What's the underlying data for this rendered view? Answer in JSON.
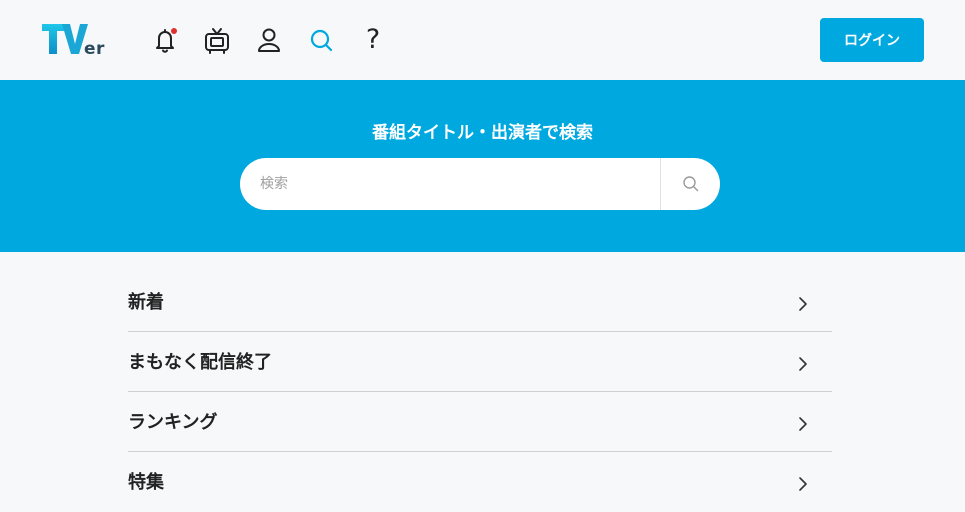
{
  "header": {
    "logo_text": "TVer",
    "icons": [
      {
        "name": "notification-bell-icon",
        "has_badge": true,
        "badge_color": "#e0302e"
      },
      {
        "name": "tv-icon"
      },
      {
        "name": "user-icon"
      },
      {
        "name": "search-icon",
        "active": true,
        "color": "#00a8e0"
      },
      {
        "name": "help-icon",
        "glyph": "?"
      }
    ],
    "login_label": "ログイン"
  },
  "banner": {
    "title": "番組タイトル・出演者で検索",
    "search_placeholder": "検索",
    "search_value": ""
  },
  "menu": {
    "items": [
      {
        "label": "新着"
      },
      {
        "label": "まもなく配信終了"
      },
      {
        "label": "ランキング"
      },
      {
        "label": "特集"
      }
    ]
  },
  "colors": {
    "accent": "#00a8e0",
    "background": "#f7f8fa",
    "text": "#222222",
    "divider": "#cfcfcf"
  }
}
